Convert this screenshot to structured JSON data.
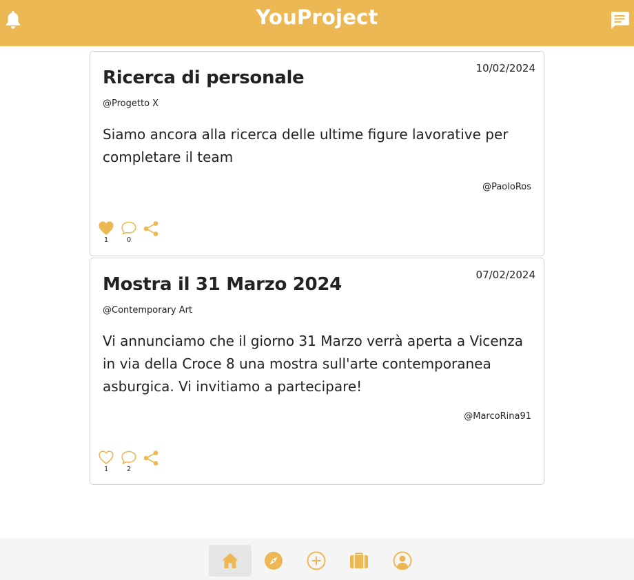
{
  "app": {
    "title": "YouProject"
  },
  "colors": {
    "accent": "#ecb854",
    "text": "#222222",
    "border": "#d0d0d0"
  },
  "header": {
    "left_icon": "bell-icon",
    "right_icon": "chat-icon"
  },
  "posts": [
    {
      "title": "Ricerca di personale",
      "date": "10/02/2024",
      "project": "@Progetto X",
      "body": "Siamo ancora alla ricerca delle ultime figure lavorative per completare il team",
      "author": "@PaoloRos",
      "liked": true,
      "likes": "1",
      "comments": "0"
    },
    {
      "title": "Mostra il 31 Marzo 2024",
      "date": "07/02/2024",
      "project": "@Contemporary Art",
      "body": "Vi annunciamo che il giorno 31 Marzo verrà aperta a Vicenza in via della Croce 8 una mostra sull'arte contemporanea asburgica. Vi invitiamo a partecipare!",
      "author": "@MarcoRina91",
      "liked": false,
      "likes": "1",
      "comments": "2"
    }
  ],
  "bottom_nav": [
    {
      "icon": "home-icon",
      "active": true
    },
    {
      "icon": "compass-icon",
      "active": false
    },
    {
      "icon": "plus-circle-icon",
      "active": false
    },
    {
      "icon": "briefcase-icon",
      "active": false
    },
    {
      "icon": "user-circle-icon",
      "active": false
    }
  ]
}
